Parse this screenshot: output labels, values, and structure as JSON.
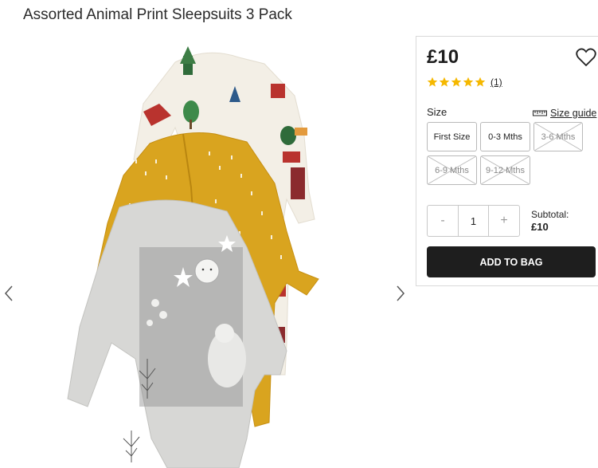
{
  "product": {
    "title": "Assorted Animal Print Sleepsuits 3 Pack",
    "price": "£10",
    "rating": {
      "stars": 5,
      "review_count": "(1)"
    }
  },
  "size": {
    "label": "Size",
    "guide_label": "Size guide",
    "options": [
      {
        "label": "First Size",
        "available": true
      },
      {
        "label": "0-3 Mths",
        "available": true
      },
      {
        "label": "3-6 Mths",
        "available": false
      },
      {
        "label": "6-9 Mths",
        "available": false
      },
      {
        "label": "9-12 Mths",
        "available": false
      }
    ]
  },
  "quantity": {
    "minus": "-",
    "value": "1",
    "plus": "+"
  },
  "subtotal": {
    "label": "Subtotal:",
    "value": "£10"
  },
  "add_to_bag_label": "ADD TO BAG",
  "icons": {
    "wishlist": "heart-icon",
    "star": "star-icon",
    "size_guide": "ruler-icon",
    "prev": "chevron-left-icon",
    "next": "chevron-right-icon"
  },
  "colors": {
    "star": "#f5b800",
    "button_bg": "#1e1e1e",
    "mustard": "#d9a41f",
    "cream": "#f3efe6",
    "grey": "#d7d7d5"
  }
}
